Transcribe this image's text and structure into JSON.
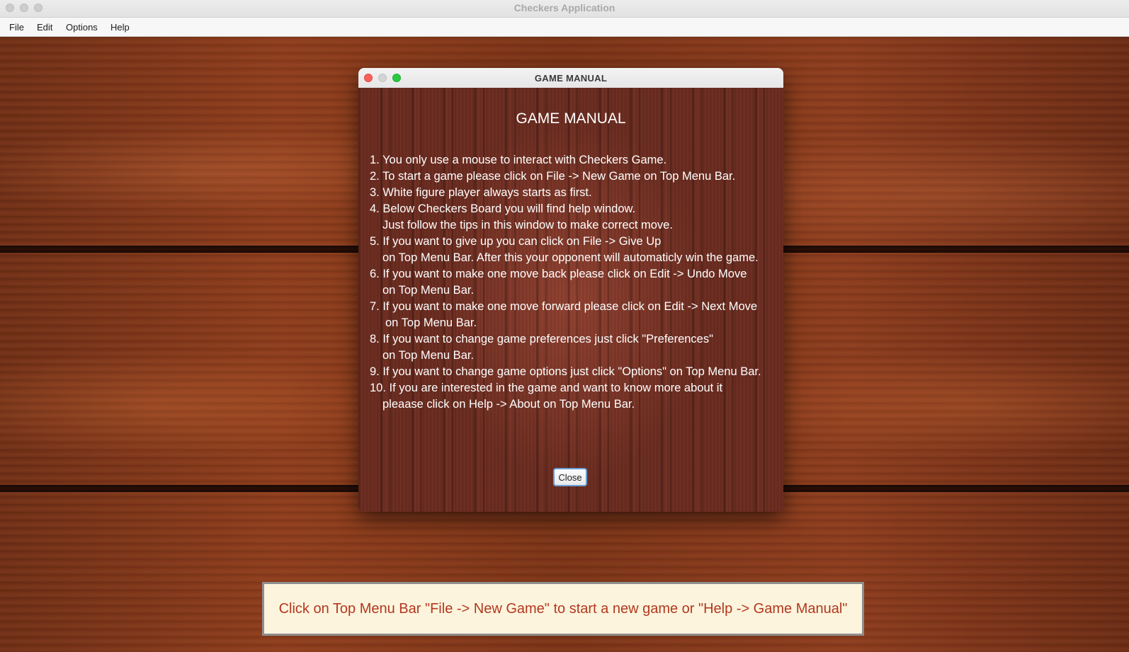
{
  "app": {
    "title": "Checkers Application"
  },
  "menubar": {
    "items": [
      "File",
      "Edit",
      "Options",
      "Help"
    ]
  },
  "dialog": {
    "window_title": "GAME MANUAL",
    "heading": "GAME MANUAL",
    "lines": [
      "1. You only use a mouse to interact with Checkers Game.",
      "2. To start a game please click on File -> New Game on Top Menu Bar.",
      "3. White figure player always starts as first.",
      "4. Below Checkers Board you will find help window.",
      "Just follow the tips in this window to make correct move.",
      "5. If you want to give up you can click on File -> Give Up",
      "on Top Menu Bar. After this your opponent will automaticly win the game.",
      "6. If you want to make one move back please click on Edit -> Undo Move",
      "on Top Menu Bar.",
      "7. If you want to make one move forward please click on Edit -> Next Move",
      "on Top Menu Bar.",
      "8. If you want to change game preferences just click \"Preferences\"",
      "on Top Menu Bar.",
      "9. If you want to change game options just click \"Options\" on Top Menu Bar.",
      "10. If you are interested in the game and want to know more about it",
      "pleaase click on Help -> About on Top Menu Bar."
    ],
    "close_label": "Close"
  },
  "hint": {
    "text": "Click on Top Menu Bar \"File -> New Game\" to start a new game or \"Help -> Game Manual\""
  },
  "colors": {
    "hint_text": "#b2381f",
    "hint_background": "#fdf4dd",
    "close_traffic_light": "#fc5f57",
    "zoom_traffic_light": "#29c941"
  }
}
